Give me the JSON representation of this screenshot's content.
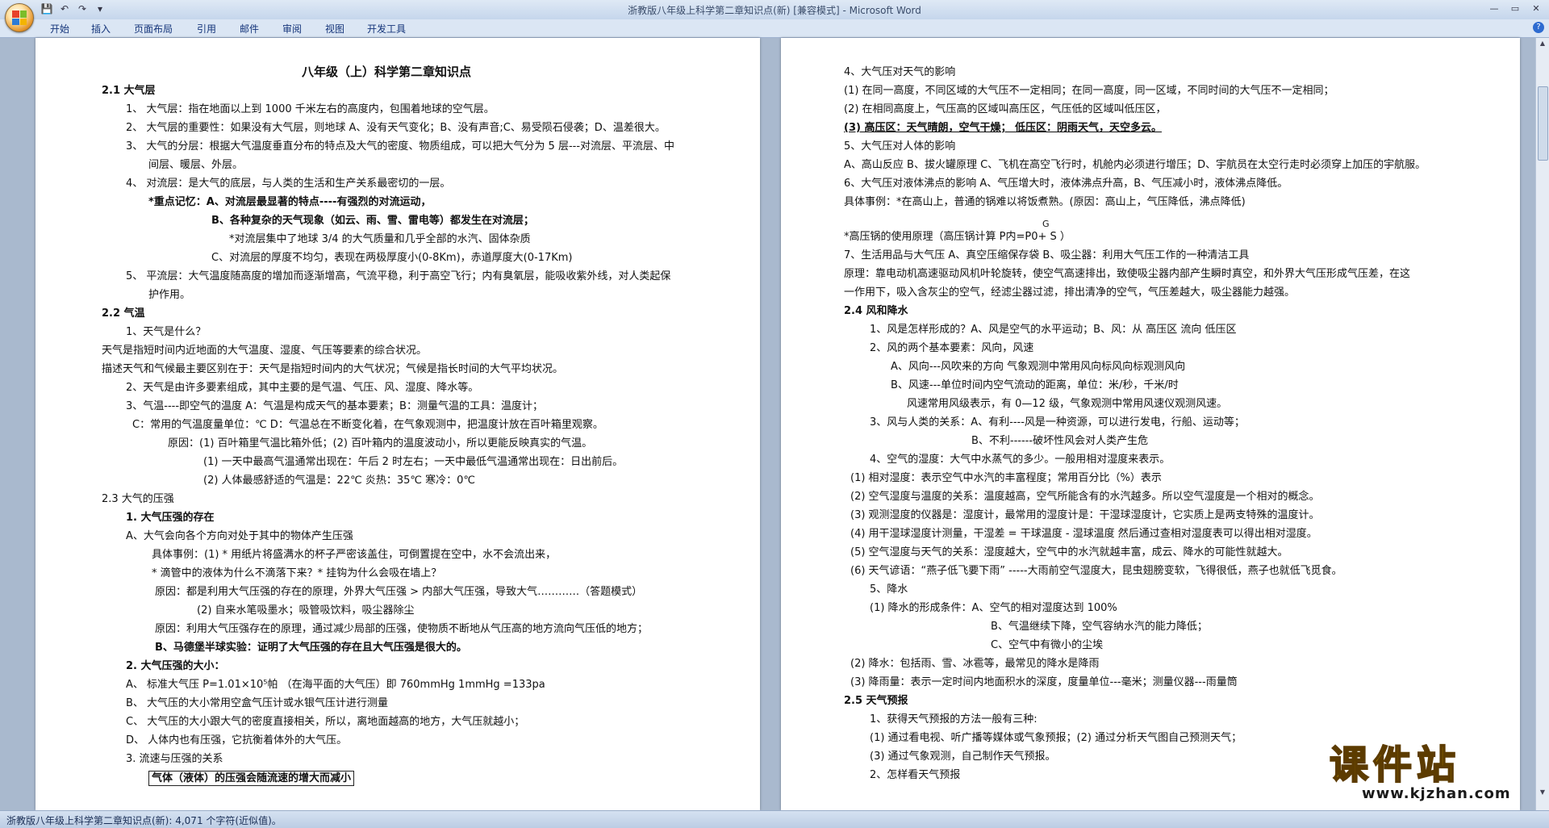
{
  "window": {
    "title": "浙教版八年级上科学第二章知识点(新) [兼容模式] - Microsoft Word"
  },
  "ribbon": {
    "tabs": [
      "开始",
      "插入",
      "页面布局",
      "引用",
      "邮件",
      "审阅",
      "视图",
      "开发工具"
    ]
  },
  "status": {
    "text": "浙教版八年级上科学第二章知识点(新): 4,071 个字符(近似值)。"
  },
  "watermark": {
    "main": "课件站",
    "sub": "www.kjzhan.com"
  },
  "page1": {
    "title": "八年级（上）科学第二章知识点",
    "lines": [
      "2.1 大气层",
      "1、  大气层：指在地面以上到 1000 千米左右的高度内，包围着地球的空气层。",
      "2、  大气层的重要性：如果没有大气层，则地球 A、没有天气变化；B、没有声音;C、易受陨石侵袭；D、温差很大。",
      "3、  大气的分层：根据大气温度垂直分布的特点及大气的密度、物质组成，可以把大气分为 5 层---对流层、平流层、中",
      "间层、暖层、外层。",
      "4、  对流层：是大气的底层，与人类的生活和生产关系最密切的一层。",
      "*重点记忆：A、对流层最显著的特点----有强烈的对流运动，",
      "B、各种复杂的天气现象（如云、雨、雪、雷电等）都发生在对流层；",
      "*对流层集中了地球 3/4 的大气质量和几乎全部的水汽、固体杂质",
      "C、对流层的厚度不均匀，表现在两极厚度小(0-8Km)，赤道厚度大(0-17Km)",
      "5、  平流层：大气温度随高度的增加而逐渐增高，气流平稳，利于高空飞行；内有臭氧层，能吸收紫外线，对人类起保",
      "护作用。",
      "2.2 气温",
      "1、天气是什么？",
      "天气是指短时间内近地面的大气温度、湿度、气压等要素的综合状况。",
      "描述天气和气候最主要区别在于：天气是指短时间内的大气状况；气候是指长时间的大气平均状况。",
      "2、天气是由许多要素组成，其中主要的是气温、气压、风、湿度、降水等。",
      "3、气温----即空气的温度   A：气温是构成天气的基本要素；B：测量气温的工具：温度计；",
      "C：常用的气温度量单位：℃  D：气温总在不断变化着，在气象观测中，把温度计放在百叶箱里观察。",
      "原因：(1) 百叶箱里气温比箱外低；(2) 百叶箱内的温度波动小，所以更能反映真实的气温。",
      "(1) 一天中最高气温通常出现在：午后 2 时左右；一天中最低气温通常出现在：日出前后。",
      "(2) 人体最感舒适的气温是：22℃ 炎热：35℃ 寒冷：0℃",
      "2.3 大气的压强",
      "1. 大气压强的存在",
      "A、大气会向各个方向对处于其中的物体产生压强",
      "具体事例：(1) * 用纸片将盛满水的杯子严密该盖住，可倒置提在空中，水不会流出来，",
      "* 滴管中的液体为什么不滴落下来？* 挂钩为什么会吸在墙上？",
      "原因：都是利用大气压强的存在的原理，外界大气压强 > 内部大气压强，导致大气…………（答题模式）",
      "(2) 自来水笔吸墨水；吸管吸饮料，吸尘器除尘",
      "原因：利用大气压强存在的原理，通过减少局部的压强，使物质不断地从气压高的地方流向气压低的地方；",
      "B、马德堡半球实验：证明了大气压强的存在且大气压强是很大的。",
      "2. 大气压强的大小：",
      "A、   标准大气压 P=1.01×10⁵帕  （在海平面的大气压）即  760mmHg  1mmHg =133pa",
      "B、   大气压的大小常用空盒气压计或水银气压计进行测量",
      "C、   大气压的大小跟大气的密度直接相关，所以，离地面越高的地方，大气压就越小；",
      "D、   人体内也有压强，它抗衡着体外的大气压。",
      "3. 流速与压强的关系",
      "气体（液体）的压强会随流速的增大而减小"
    ]
  },
  "page2": {
    "lines": [
      "4、大气压对天气的影响",
      "(1) 在同一高度，不同区域的大气压不一定相同；在同一高度，同一区域，不同时间的大气压不一定相同；",
      "(2) 在相同高度上，气压高的区域叫高压区，气压低的区域叫低压区，",
      "(3) 高压区：天气晴朗，空气干燥；     低压区：阴雨天气，天空多云。",
      "5、大气压对人体的影响",
      "A、高山反应 B、拔火罐原理 C、飞机在高空飞行时，机舱内必须进行增压；D、宇航员在太空行走时必须穿上加压的宇航服。",
      "6、大气压对液体沸点的影响 A、气压增大时，液体沸点升高，B、气压减小时，液体沸点降低。",
      "具体事例：*在高山上，普通的锅难以将饭煮熟。(原因：高山上，气压降低，沸点降低)",
      "G",
      "*高压锅的使用原理（高压锅计算 P内=P0+ S ）",
      "7、生活用品与大气压 A、真空压缩保存袋 B、吸尘器：利用大气压工作的一种清洁工具",
      "原理：靠电动机高速驱动风机叶轮旋转，使空气高速排出，致使吸尘器内部产生瞬时真空，和外界大气压形成气压差，在这",
      "一作用下，吸入含灰尘的空气，经滤尘器过滤，排出清净的空气，气压差越大，吸尘器能力越强。",
      "2.4 风和降水",
      "1、风是怎样形成的？A、风是空气的水平运动；B、风：从  高压区  流向  低压区",
      "2、风的两个基本要素：风向，风速",
      "A、风向---风吹来的方向    气象观测中常用风向标风向标观测风向",
      "B、风速---单位时间内空气流动的距离，单位：米/秒，千米/时",
      "风速常用风级表示，有 0—12 级，气象观测中常用风速仪观测风速。",
      "3、风与人类的关系：A、有利----风是一种资源，可以进行发电，行船、运动等；",
      "B、不利------破坏性风会对人类产生危",
      "4、空气的湿度：大气中水蒸气的多少。一般用相对湿度来表示。",
      "(1) 相对湿度：表示空气中水汽的丰富程度；常用百分比（%）表示",
      "(2) 空气湿度与温度的关系：温度越高，空气所能含有的水汽越多。所以空气湿度是一个相对的概念。",
      "(3) 观测湿度的仪器是：湿度计，最常用的湿度计是：干湿球湿度计，它实质上是两支特殊的温度计。",
      "(4) 用干湿球湿度计测量，干湿差 = 干球温度 - 湿球温度   然后通过查相对湿度表可以得出相对湿度。",
      "(5) 空气湿度与天气的关系：湿度越大，空气中的水汽就越丰富，成云、降水的可能性就越大。",
      "(6) 天气谚语：“燕子低飞要下雨” -----大雨前空气湿度大，昆虫翅膀变软，飞得很低，燕子也就低飞觅食。",
      "5、降水",
      "(1) 降水的形成条件：A、空气的相对湿度达到 100%",
      "B、气温继续下降，空气容纳水汽的能力降低；",
      "C、空气中有微小的尘埃",
      "(2) 降水：包括雨、雪、冰雹等，最常见的降水是降雨",
      "(3) 降雨量：表示一定时间内地面积水的深度，度量单位---毫米；测量仪器---雨量筒",
      "2.5 天气预报",
      "1、获得天气预报的方法一般有三种:",
      "(1) 通过看电视、听广播等媒体或气象预报；(2) 通过分析天气图自己预测天气；",
      "(3) 通过气象观测，自己制作天气预报。",
      "2、怎样看天气预报"
    ]
  }
}
